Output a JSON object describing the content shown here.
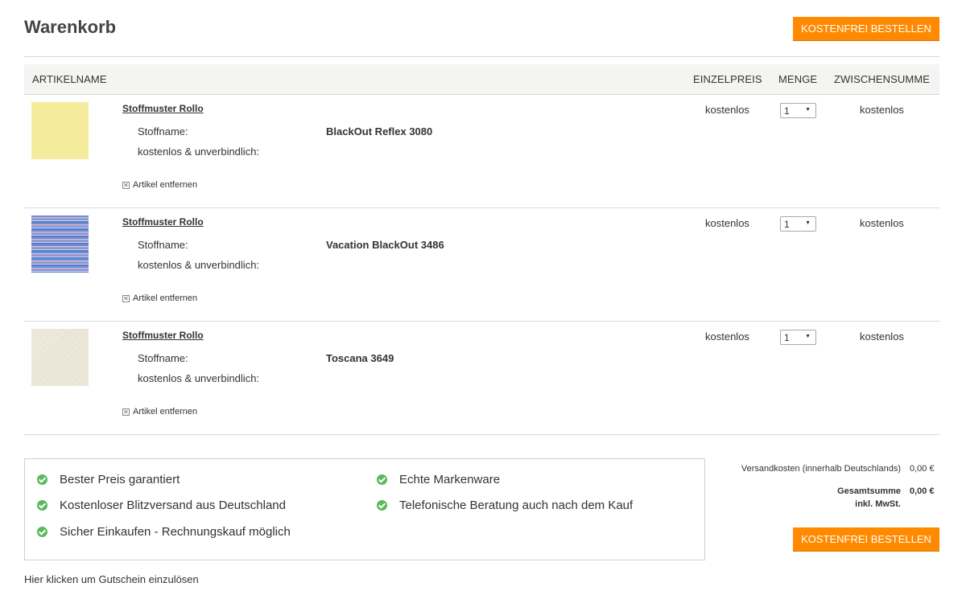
{
  "cart": {
    "title": "Warenkorb",
    "order_button": "KOSTENFREI BESTELLEN"
  },
  "table": {
    "headers": {
      "name": "ARTIKELNAME",
      "price": "EINZELPREIS",
      "qty": "MENGE",
      "subtotal": "ZWISCHENSUMME"
    },
    "items": [
      {
        "name": "Stoffmuster Rollo",
        "attr_label_1": "Stoffname:",
        "attr_label_2": "kostenlos & unverbindlich:",
        "fabric": "BlackOut Reflex 3080",
        "remove": "Artikel entfernen",
        "price": "kostenlos",
        "qty": "1",
        "subtotal": "kostenlos",
        "swatch": "yellow"
      },
      {
        "name": "Stoffmuster Rollo",
        "attr_label_1": "Stoffname:",
        "attr_label_2": "kostenlos & unverbindlich:",
        "fabric": "Vacation BlackOut 3486",
        "remove": "Artikel entfernen",
        "price": "kostenlos",
        "qty": "1",
        "subtotal": "kostenlos",
        "swatch": "blue-stripes"
      },
      {
        "name": "Stoffmuster Rollo",
        "attr_label_1": "Stoffname:",
        "attr_label_2": "kostenlos & unverbindlich:",
        "fabric": "Toscana 3649",
        "remove": "Artikel entfernen",
        "price": "kostenlos",
        "qty": "1",
        "subtotal": "kostenlos",
        "swatch": "beige-linen"
      }
    ]
  },
  "trust": {
    "items": [
      "Bester Preis garantiert",
      "Kostenloser Blitzversand aus Deutschland",
      "Sicher Einkaufen - Rechnungskauf möglich",
      "Echte Markenware",
      "Telefonische Beratung auch nach dem Kauf"
    ],
    "icon": "check-circle-icon"
  },
  "summary": {
    "shipping_label": "Versandkosten (innerhalb Deutschlands)",
    "shipping_value": "0,00 €",
    "total_label": "Gesamtsumme",
    "total_value": "0,00 €",
    "vat_label": "inkl. MwSt."
  },
  "voucher": {
    "link": "Hier klicken um Gutschein einzulösen"
  },
  "colors": {
    "accent": "#ff8a00",
    "check": "#5cb85c",
    "header_bg": "#f4f4f2"
  }
}
